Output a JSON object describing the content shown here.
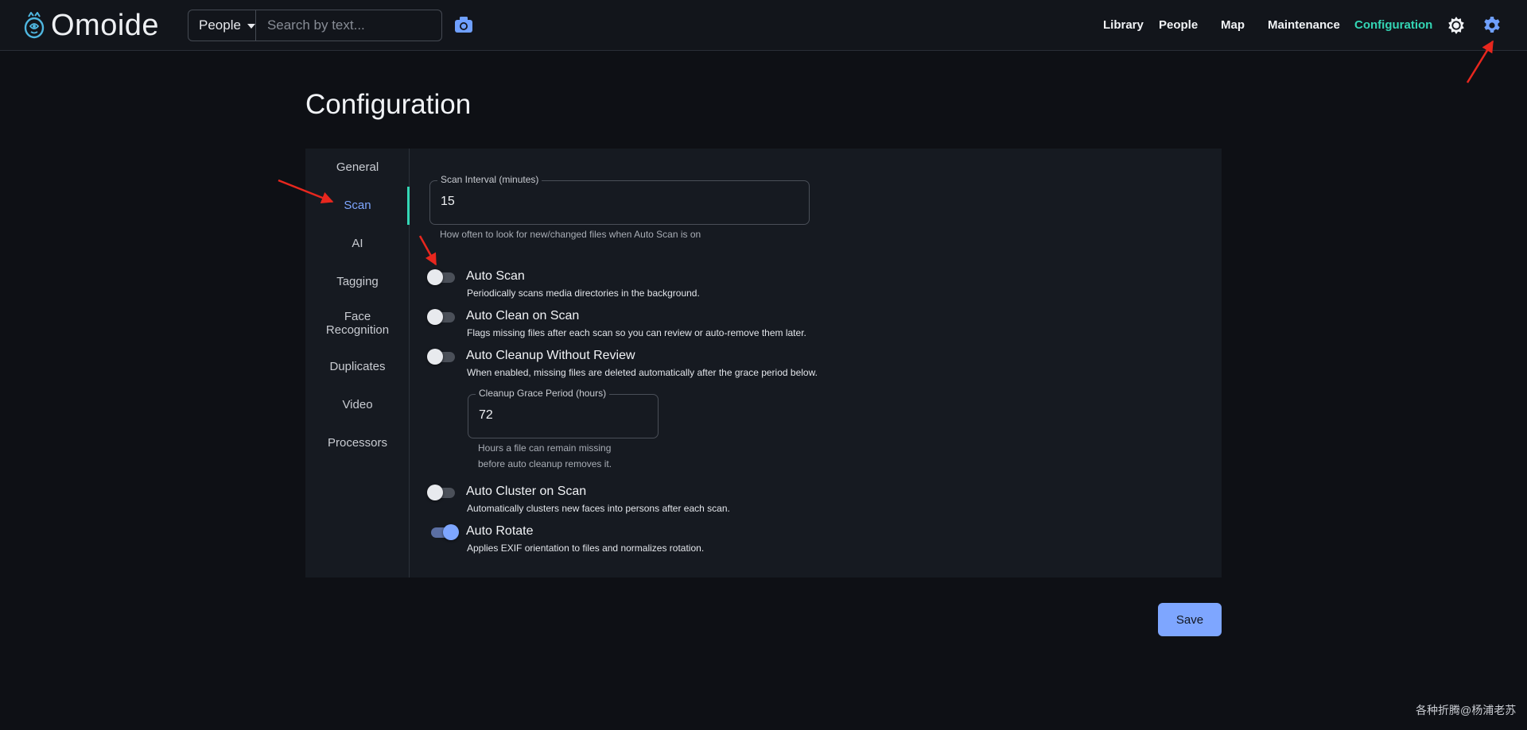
{
  "app": {
    "name": "Omoide"
  },
  "search": {
    "mode": "People",
    "placeholder": "Search by text..."
  },
  "nav": {
    "items": [
      "Library",
      "People",
      "Map",
      "Maintenance",
      "Configuration"
    ],
    "active": "Configuration"
  },
  "page": {
    "title": "Configuration"
  },
  "sidebar": {
    "items": [
      "General",
      "Scan",
      "AI",
      "Tagging",
      "Face Recognition",
      "Duplicates",
      "Video",
      "Processors"
    ],
    "active": "Scan"
  },
  "scan": {
    "interval": {
      "label": "Scan Interval (minutes)",
      "value": "15",
      "hint": "How often to look for new/changed files when Auto Scan is on"
    },
    "options": [
      {
        "label": "Auto Scan",
        "description": "Periodically scans media directories in the background.",
        "enabled": false
      },
      {
        "label": "Auto Clean on Scan",
        "description": "Flags missing files after each scan so you can review or auto-remove them later.",
        "enabled": false
      },
      {
        "label": "Auto Cleanup Without Review",
        "description": "When enabled, missing files are deleted automatically after the grace period below.",
        "enabled": false
      },
      {
        "label": "Auto Cluster on Scan",
        "description": "Automatically clusters new faces into persons after each scan.",
        "enabled": false
      },
      {
        "label": "Auto Rotate",
        "description": "Applies EXIF orientation to files and normalizes rotation.",
        "enabled": true
      }
    ],
    "grace": {
      "label": "Cleanup Grace Period (hours)",
      "value": "72",
      "hint_line1": "Hours a file can remain missing",
      "hint_line2": "before auto cleanup removes it."
    }
  },
  "actions": {
    "save": "Save"
  },
  "watermark": "各种折腾@杨浦老苏",
  "colors": {
    "accent": "#34d6b5",
    "primary": "#7ea6ff",
    "background": "#0e1015",
    "panel": "#161a21",
    "annotation": "#e8271e"
  },
  "icons": [
    "brand-logo-icon",
    "caret-down-icon",
    "camera-icon",
    "theme-sun-icon",
    "gear-icon"
  ]
}
